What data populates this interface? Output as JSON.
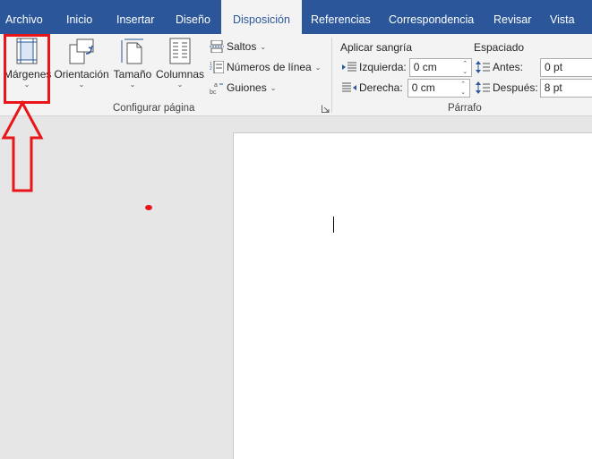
{
  "tabs": [
    {
      "label": "Archivo",
      "active": false
    },
    {
      "label": "Inicio",
      "active": false
    },
    {
      "label": "Insertar",
      "active": false
    },
    {
      "label": "Diseño",
      "active": false
    },
    {
      "label": "Disposición",
      "active": true
    },
    {
      "label": "Referencias",
      "active": false
    },
    {
      "label": "Correspondencia",
      "active": false
    },
    {
      "label": "Revisar",
      "active": false
    },
    {
      "label": "Vista",
      "active": false
    }
  ],
  "page_setup": {
    "margins_label": "Márgenes",
    "orientation_label": "Orientación",
    "size_label": "Tamaño",
    "columns_label": "Columnas",
    "breaks_label": "Saltos",
    "line_numbers_label": "Números de línea",
    "hyphenation_label": "Guiones",
    "group_label": "Configurar página"
  },
  "paragraph": {
    "indent_title": "Aplicar sangría",
    "left_label": "Izquierda:",
    "left_value": "0 cm",
    "right_label": "Derecha:",
    "right_value": "0 cm",
    "spacing_title": "Espaciado",
    "before_label": "Antes:",
    "before_value": "0 pt",
    "after_label": "Después:",
    "after_value": "8 pt",
    "group_label": "Párrafo"
  },
  "colors": {
    "ribbon_blue": "#2b579a",
    "annotation_red": "#e8151b",
    "ribbon_bg": "#f3f3f3",
    "canvas_bg": "#e6e6e6"
  },
  "icons": [
    "margins-icon",
    "orientation-icon",
    "size-icon",
    "columns-icon",
    "breaks-icon",
    "line-numbers-icon",
    "hyphenation-icon",
    "indent-left-icon",
    "indent-right-icon",
    "spacing-before-icon",
    "spacing-after-icon"
  ]
}
